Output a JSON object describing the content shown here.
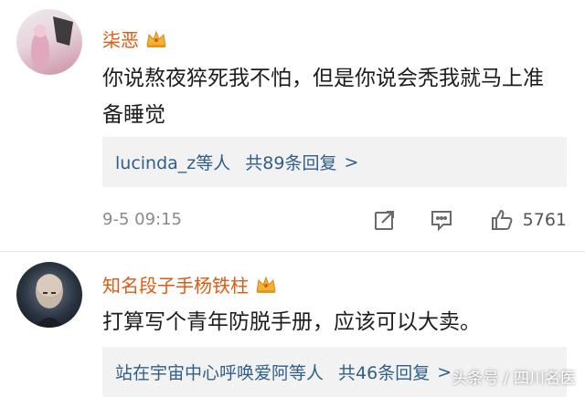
{
  "comments": [
    {
      "username": "柒恶",
      "text": "你说熬夜猝死我不怕，但是你说会秃我就马上准备睡觉",
      "reply_users": "lucinda_z等人",
      "reply_count": "共89条回复",
      "reply_chevron": ">",
      "timestamp": "9-5 09:15",
      "likes": "5761"
    },
    {
      "username": "知名段子手杨铁柱",
      "text": "打算写个青年防脱手册，应该可以大卖。",
      "reply_users": "站在宇宙中心呼唤爱阿等人",
      "reply_count": "共46条回复",
      "reply_chevron": ">"
    }
  ],
  "watermark": "头条号 / 四川名医",
  "colors": {
    "username": "#e05a12",
    "reply_link": "#2f5f8a",
    "reply_bg": "#f2f2f2",
    "muted": "#8a8a8a"
  },
  "icons": [
    "crown-badge-icon",
    "repost-icon",
    "comment-icon",
    "thumbs-up-icon"
  ]
}
